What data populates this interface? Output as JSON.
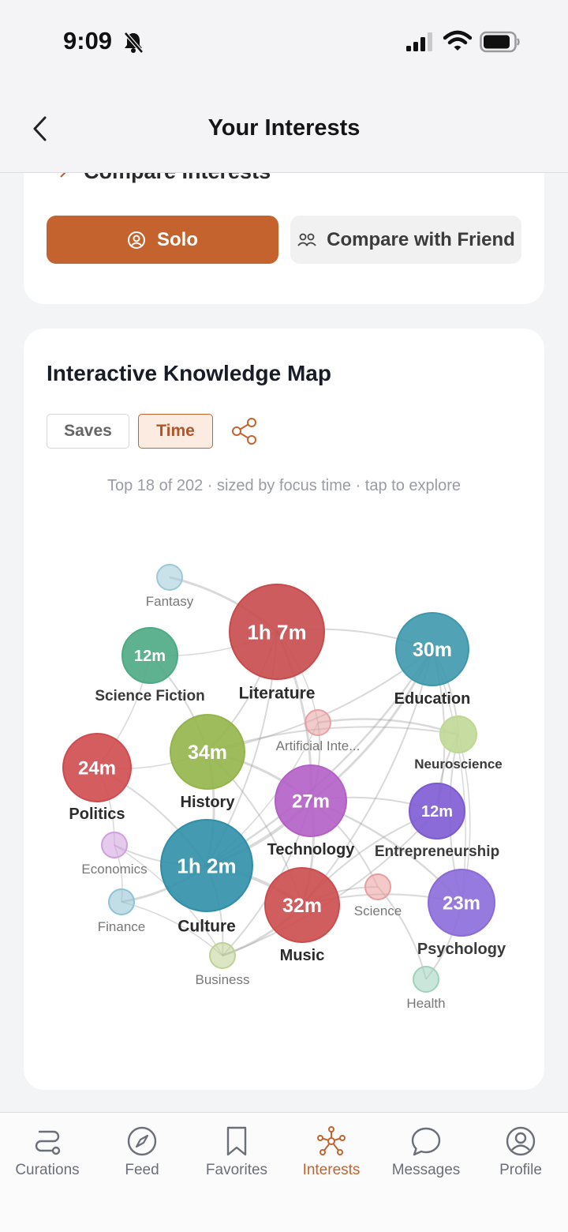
{
  "status": {
    "time": "9:09"
  },
  "header": {
    "title": "Your Interests"
  },
  "compare_section": {
    "cut_title": "Compare Interests",
    "solo_label": "Solo",
    "compare_label": "Compare with Friend"
  },
  "map": {
    "title": "Interactive Knowledge Map",
    "toggle_saves": "Saves",
    "toggle_time": "Time",
    "caption": "Top 18 of 202 · sized by focus time · tap to explore",
    "nodes": [
      {
        "id": "literature",
        "label": "Literature",
        "value": "1h 7m",
        "color": "#c84a4c"
      },
      {
        "id": "education",
        "label": "Education",
        "value": "30m",
        "color": "#3e98ad"
      },
      {
        "id": "science_fiction",
        "label": "Science Fiction",
        "value": "12m",
        "color": "#4eaa84"
      },
      {
        "id": "fantasy",
        "label": "Fantasy",
        "value": "",
        "color": "#9cc9d6"
      },
      {
        "id": "history",
        "label": "History",
        "value": "34m",
        "color": "#94b54a"
      },
      {
        "id": "politics",
        "label": "Politics",
        "value": "24m",
        "color": "#cf4b4f"
      },
      {
        "id": "artificial_intelligence",
        "label": "Artificial Inte...",
        "value": "",
        "color": "#e7a1a3"
      },
      {
        "id": "neuroscience",
        "label": "Neuroscience",
        "value": "",
        "color": "#c0d896"
      },
      {
        "id": "technology",
        "label": "Technology",
        "value": "27m",
        "color": "#b45fc6"
      },
      {
        "id": "entrepreneurship",
        "label": "Entrepreneurship",
        "value": "12m",
        "color": "#7d5bd3"
      },
      {
        "id": "economics",
        "label": "Economics",
        "value": "",
        "color": "#cf9fde"
      },
      {
        "id": "culture",
        "label": "Culture",
        "value": "1h 2m",
        "color": "#2f8fa8"
      },
      {
        "id": "finance",
        "label": "Finance",
        "value": "",
        "color": "#8ec2d4"
      },
      {
        "id": "music",
        "label": "Music",
        "value": "32m",
        "color": "#cc4c4e"
      },
      {
        "id": "science",
        "label": "Science",
        "value": "",
        "color": "#ea9c9e"
      },
      {
        "id": "psychology",
        "label": "Psychology",
        "value": "23m",
        "color": "#8b6bd9"
      },
      {
        "id": "business",
        "label": "Business",
        "value": "",
        "color": "#bfd293"
      },
      {
        "id": "health",
        "label": "Health",
        "value": "",
        "color": "#9fd2bb"
      }
    ]
  },
  "tabs": [
    {
      "label": "Curations",
      "icon": "route-icon"
    },
    {
      "label": "Feed",
      "icon": "compass-icon"
    },
    {
      "label": "Favorites",
      "icon": "bookmark-icon"
    },
    {
      "label": "Interests",
      "icon": "network-icon"
    },
    {
      "label": "Messages",
      "icon": "chat-bubble-icon"
    },
    {
      "label": "Profile",
      "icon": "user-circle-icon"
    }
  ],
  "colors": {
    "accent": "#c4632e",
    "tab_inactive": "#6b6f78"
  }
}
